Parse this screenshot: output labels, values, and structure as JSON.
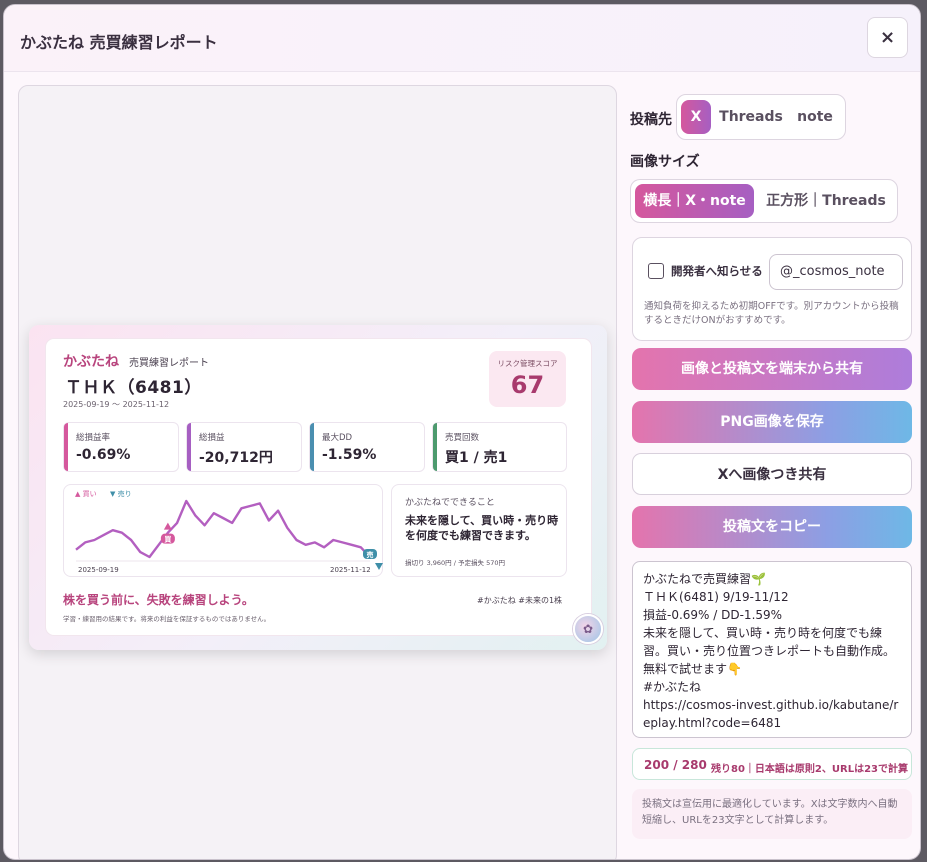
{
  "dialog": {
    "title": "かぶたね 売買練習レポート",
    "close_label": "×"
  },
  "report": {
    "brand": "かぶたね",
    "subtitle": "売買練習レポート",
    "ticker": "ＴＨＫ（6481）",
    "period": "2025-09-19 ～ 2025-11-12",
    "risk": {
      "label": "リスク管理スコア",
      "value": "67"
    },
    "metrics": [
      {
        "label": "総損益率",
        "value": "-0.69%",
        "color": "#d5589d"
      },
      {
        "label": "総損益",
        "value": "-20,712円",
        "color": "#a65fc2"
      },
      {
        "label": "最大DD",
        "value": "-1.59%",
        "color": "#4a8fb0"
      },
      {
        "label": "売買回数",
        "value": "買1 / 売1",
        "color": "#4d9a6e"
      }
    ],
    "chart": {
      "legend_buy": "▲ 買い",
      "legend_sell": "▼ 売り",
      "x_start": "2025-09-19",
      "x_end": "2025-11-12",
      "buy_marker": "買",
      "sell_marker": "売"
    },
    "can_title": "かぶたねでできること",
    "can_text": "未来を隠して、買い時・売り時を何度でも練習できます。",
    "can_foot": "損切り 3,960円 / 予定損失 570円",
    "slogan": "株を買う前に、失敗を練習しよう。",
    "tags": "#かぶたね  #未来の1株",
    "disclaimer": "学習・練習用の結果です。将来の利益を保証するものではありません。"
  },
  "chart_data": {
    "type": "line",
    "series": [
      {
        "values": [
          42,
          45,
          46,
          48,
          50,
          49,
          46,
          41,
          39,
          44,
          49,
          53,
          62,
          56,
          52,
          57,
          55,
          53,
          59,
          60,
          61,
          54,
          58,
          51,
          46,
          44,
          45,
          43,
          46,
          45,
          44,
          43,
          39
        ]
      }
    ],
    "markers": [
      {
        "type": "buy",
        "index": 10,
        "label": "買"
      },
      {
        "type": "sell",
        "index": 32,
        "label": "売"
      }
    ],
    "colors": {
      "line": "#b35fc0",
      "buy": "#d5589d",
      "sell": "#3f8fa8"
    }
  },
  "sidebar": {
    "post_to_label": "投稿先",
    "post_targets": [
      "X",
      "Threads",
      "note"
    ],
    "image_size_label": "画像サイズ",
    "sizes": [
      "横長｜X・note",
      "正方形｜Threads"
    ],
    "notify_label": "開発者へ知らせる",
    "notify_handle": "@_cosmos_note",
    "notify_note": "通知負荷を抑えるため初期OFFです。別アカウントから投稿するときだけONがおすすめです。",
    "buttons": {
      "share_device": "画像と投稿文を端末から共有",
      "save_png": "PNG画像を保存",
      "share_x": "Xへ画像つき共有",
      "copy_text": "投稿文をコピー"
    },
    "post_text": "かぶたねで売買練習🌱\nＴＨＫ(6481) 9/19-11/12\n損益-0.69% / DD-1.59%\n未来を隠して、買い時・売り時を何度でも練習。買い・売り位置つきレポートも自動作成。無料で試せます👇\n#かぶたね\nhttps://cosmos-invest.github.io/kabutane/replay.html?code=6481",
    "counter": "200 / 280",
    "counter_note": "残り80｜日本語は原則2、URLは23で計算",
    "info": "投稿文は宣伝用に最適化しています。Xは文字数内へ自動短縮し、URLを23文字として計算します。"
  },
  "accent": "#d5589d"
}
